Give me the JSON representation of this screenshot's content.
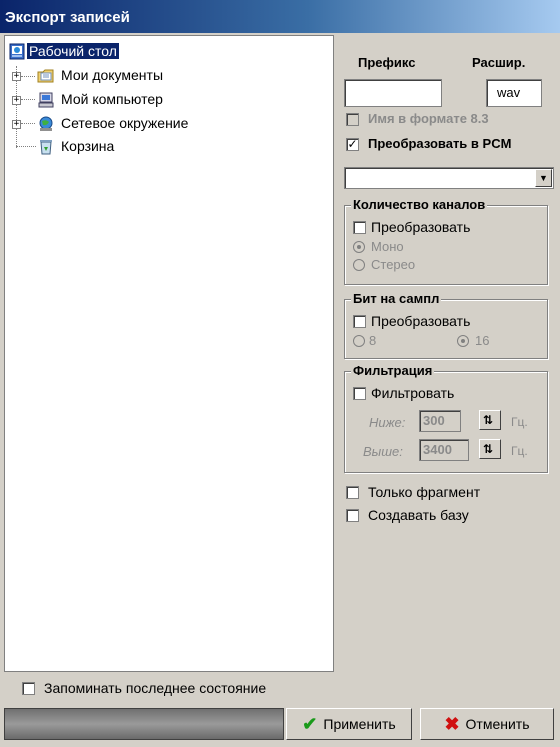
{
  "window": {
    "title": "Экспорт записей"
  },
  "tree": {
    "items": [
      {
        "label": "Рабочий стол",
        "icon": "desktop-icon",
        "selected": true
      },
      {
        "label": "Мои документы",
        "icon": "folder-icon"
      },
      {
        "label": "Мой компьютер",
        "icon": "computer-icon"
      },
      {
        "label": "Сетевое окружение",
        "icon": "network-icon"
      },
      {
        "label": "Корзина",
        "icon": "recycle-bin-icon"
      }
    ]
  },
  "remember": {
    "label": "Запоминать последнее состояние",
    "checked": false
  },
  "settings": {
    "prefix_header": "Префикс",
    "ext_header": "Расшир.",
    "prefix_value": "",
    "ext_value": "wav",
    "name83_label": "Имя в формате 8.3",
    "name83_checked": false,
    "convert_pcm_label": "Преобразовать в PCM",
    "convert_pcm_checked": true,
    "format_value": "",
    "channels": {
      "title": "Количество каналов",
      "convert_label": "Преобразовать",
      "mono_label": "Моно",
      "stereo_label": "Стерео",
      "selected": "Моно"
    },
    "bits": {
      "title": "Бит на сампл",
      "convert_label": "Преобразовать",
      "opt8_label": "8",
      "opt16_label": "16",
      "selected": "16"
    },
    "filter": {
      "title": "Фильтрация",
      "enable_label": "Фильтровать",
      "low_label": "Ниже:",
      "low_value": "300",
      "high_label": "Выше:",
      "high_value": "3400",
      "unit": "Гц."
    },
    "fragment_label": "Только фрагмент",
    "create_db_label": "Создавать базу"
  },
  "buttons": {
    "apply": "Применить",
    "cancel": "Отменить"
  }
}
